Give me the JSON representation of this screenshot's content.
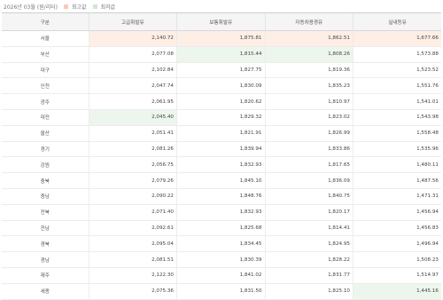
{
  "caption": {
    "period": "2026년 03월 (원/리터)",
    "legend_high": "최고값",
    "legend_low": "최저값"
  },
  "colors": {
    "high": "#fdeee6",
    "low": "#edf6ec"
  },
  "headers": [
    "구분",
    "고급휘발유",
    "보통휘발유",
    "자동차용경유",
    "실내등유"
  ],
  "rows": [
    {
      "region": "서울",
      "values": [
        "2,140.72",
        "1,875.81",
        "1,862.51",
        "1,677.66"
      ],
      "marks": [
        "high",
        "high",
        "high",
        "high"
      ]
    },
    {
      "region": "부산",
      "values": [
        "2,077.08",
        "1,815.44",
        "1,808.26",
        "1,573.88"
      ],
      "marks": [
        "",
        "low",
        "low",
        ""
      ]
    },
    {
      "region": "대구",
      "values": [
        "2,102.84",
        "1,827.75",
        "1,819.36",
        "1,523.52"
      ],
      "marks": [
        "",
        "",
        "",
        ""
      ]
    },
    {
      "region": "인천",
      "values": [
        "2,047.74",
        "1,830.09",
        "1,835.23",
        "1,551.76"
      ],
      "marks": [
        "",
        "",
        "",
        ""
      ]
    },
    {
      "region": "광주",
      "values": [
        "2,061.95",
        "1,820.62",
        "1,810.97",
        "1,541.01"
      ],
      "marks": [
        "",
        "",
        "",
        ""
      ]
    },
    {
      "region": "대전",
      "values": [
        "2,045.40",
        "1,829.32",
        "1,823.02",
        "1,543.98"
      ],
      "marks": [
        "low",
        "",
        "",
        ""
      ]
    },
    {
      "region": "울산",
      "values": [
        "2,051.41",
        "1,821.91",
        "1,826.99",
        "1,558.48"
      ],
      "marks": [
        "",
        "",
        "",
        ""
      ]
    },
    {
      "region": "경기",
      "values": [
        "2,081.26",
        "1,839.94",
        "1,833.86",
        "1,535.96"
      ],
      "marks": [
        "",
        "",
        "",
        ""
      ]
    },
    {
      "region": "강원",
      "values": [
        "2,056.75",
        "1,832.93",
        "1,817.65",
        "1,480.11"
      ],
      "marks": [
        "",
        "",
        "",
        ""
      ]
    },
    {
      "region": "충북",
      "values": [
        "2,079.26",
        "1,845.10",
        "1,836.09",
        "1,487.56"
      ],
      "marks": [
        "",
        "",
        "",
        ""
      ]
    },
    {
      "region": "충남",
      "values": [
        "2,090.22",
        "1,848.76",
        "1,840.75",
        "1,471.31"
      ],
      "marks": [
        "",
        "",
        "",
        ""
      ]
    },
    {
      "region": "전북",
      "values": [
        "2,071.40",
        "1,832.93",
        "1,820.17",
        "1,456.94"
      ],
      "marks": [
        "",
        "",
        "",
        ""
      ]
    },
    {
      "region": "전남",
      "values": [
        "2,092.61",
        "1,825.68",
        "1,814.41",
        "1,456.83"
      ],
      "marks": [
        "",
        "",
        "",
        ""
      ]
    },
    {
      "region": "경북",
      "values": [
        "2,095.04",
        "1,834.45",
        "1,824.95",
        "1,496.94"
      ],
      "marks": [
        "",
        "",
        "",
        ""
      ]
    },
    {
      "region": "경남",
      "values": [
        "2,081.51",
        "1,830.39",
        "1,828.22",
        "1,508.23"
      ],
      "marks": [
        "",
        "",
        "",
        ""
      ]
    },
    {
      "region": "제주",
      "values": [
        "2,122.30",
        "1,841.02",
        "1,831.77",
        "1,514.97"
      ],
      "marks": [
        "",
        "",
        "",
        ""
      ]
    },
    {
      "region": "세종",
      "values": [
        "2,075.36",
        "1,831.50",
        "1,825.10",
        "1,445.16"
      ],
      "marks": [
        "",
        "",
        "",
        "low"
      ]
    }
  ]
}
